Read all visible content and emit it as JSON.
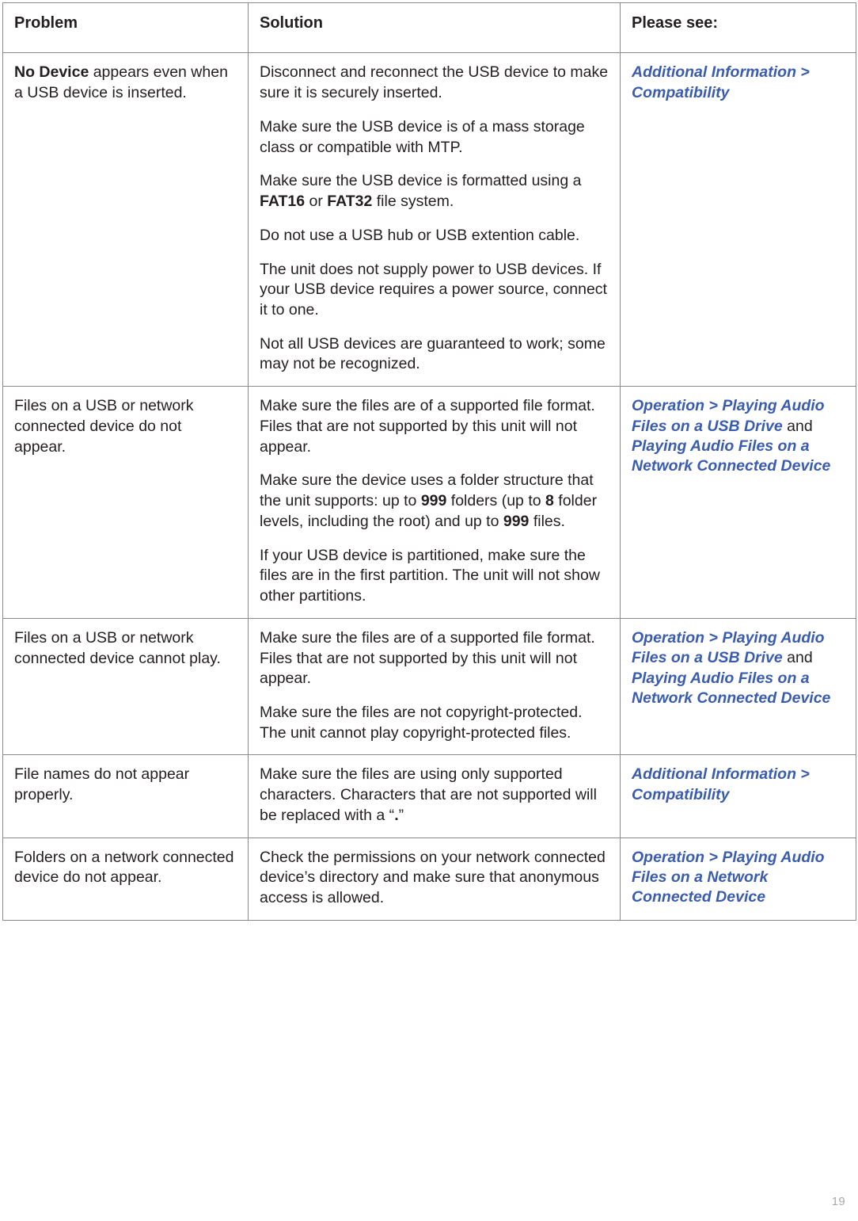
{
  "page": {
    "number": "19",
    "link_color": "#3a5cae",
    "text_color": "#231f20",
    "border_color": "#8a8a8a"
  },
  "table": {
    "headers": {
      "problem": "Problem",
      "solution": "Solution",
      "please_see": "Please see:"
    },
    "rows": [
      {
        "problem": {
          "bold_lead": "No Device",
          "rest": " appears even when a USB device is inserted."
        },
        "solution_paragraphs": [
          {
            "parts": [
              {
                "text": "Disconnect and reconnect the USB device to make sure it is securely inserted.",
                "bold": false
              }
            ]
          },
          {
            "parts": [
              {
                "text": "Make sure the USB device is of a mass storage class or compatible with MTP.",
                "bold": false
              }
            ]
          },
          {
            "parts": [
              {
                "text": "Make sure the USB device is formatted using a ",
                "bold": false
              },
              {
                "text": "FAT16",
                "bold": true
              },
              {
                "text": " or ",
                "bold": false
              },
              {
                "text": "FAT32",
                "bold": true
              },
              {
                "text": " file system.",
                "bold": false
              }
            ]
          },
          {
            "parts": [
              {
                "text": "Do not use a USB hub or USB extention cable.",
                "bold": false
              }
            ]
          },
          {
            "parts": [
              {
                "text": "The unit does not supply power to USB devices. If your USB device requires a power source, connect it to one.",
                "bold": false
              }
            ]
          },
          {
            "parts": [
              {
                "text": "Not all USB devices are guaranteed to work; some may not be recognized.",
                "bold": false
              }
            ]
          }
        ],
        "see_parts": [
          {
            "text": "Additional Information > Compatibility",
            "link": true
          }
        ]
      },
      {
        "problem": {
          "bold_lead": "",
          "rest": "Files on a USB or network connected device do not appear."
        },
        "solution_paragraphs": [
          {
            "parts": [
              {
                "text": "Make sure the files are of a supported file format. Files that are not supported by this unit will not appear.",
                "bold": false
              }
            ]
          },
          {
            "parts": [
              {
                "text": "Make sure the device uses a folder structure that the unit supports: up to ",
                "bold": false
              },
              {
                "text": "999",
                "bold": true
              },
              {
                "text": " folders (up to ",
                "bold": false
              },
              {
                "text": "8",
                "bold": true
              },
              {
                "text": " folder levels, including the root) and up to ",
                "bold": false
              },
              {
                "text": "999",
                "bold": true
              },
              {
                "text": " files.",
                "bold": false
              }
            ]
          },
          {
            "parts": [
              {
                "text": "If your USB device is partitioned, make sure the files are in the first partition. The unit will not show other partitions.",
                "bold": false
              }
            ]
          }
        ],
        "see_parts": [
          {
            "text": "Operation > Playing Audio Files on a USB Drive",
            "link": true
          },
          {
            "text": " and ",
            "link": false
          },
          {
            "text": "Playing Audio Files on a Network Connected Device",
            "link": true
          }
        ]
      },
      {
        "problem": {
          "bold_lead": "",
          "rest": "Files on a USB or network connected device cannot play."
        },
        "solution_paragraphs": [
          {
            "parts": [
              {
                "text": "Make sure the files are of a supported file format. Files that are not supported by this unit will not appear.",
                "bold": false
              }
            ]
          },
          {
            "parts": [
              {
                "text": "Make sure the files are not copyright-protected. The unit cannot play copyright-protected files.",
                "bold": false
              }
            ]
          }
        ],
        "see_parts": [
          {
            "text": "Operation > Playing Audio Files on a USB Drive",
            "link": true
          },
          {
            "text": " and ",
            "link": false
          },
          {
            "text": "Playing Audio Files on a Network Connected Device",
            "link": true
          }
        ]
      },
      {
        "problem": {
          "bold_lead": "",
          "rest": "File names do not appear properly."
        },
        "solution_paragraphs": [
          {
            "parts": [
              {
                "text": "Make sure the files are using only supported characters. Characters that are not supported will be replaced with a “",
                "bold": false
              },
              {
                "text": ".",
                "bold": true
              },
              {
                "text": "”",
                "bold": false
              }
            ]
          }
        ],
        "see_parts": [
          {
            "text": "Additional Information > Compatibility",
            "link": true
          }
        ]
      },
      {
        "problem": {
          "bold_lead": "",
          "rest": "Folders on a network connected device do not appear."
        },
        "solution_paragraphs": [
          {
            "parts": [
              {
                "text": "Check the permissions on your network connected device’s directory and make sure that anonymous access is allowed.",
                "bold": false
              }
            ]
          }
        ],
        "see_parts": [
          {
            "text": "Operation > Playing Audio Files on a Network Connected Device",
            "link": true
          }
        ]
      }
    ]
  }
}
